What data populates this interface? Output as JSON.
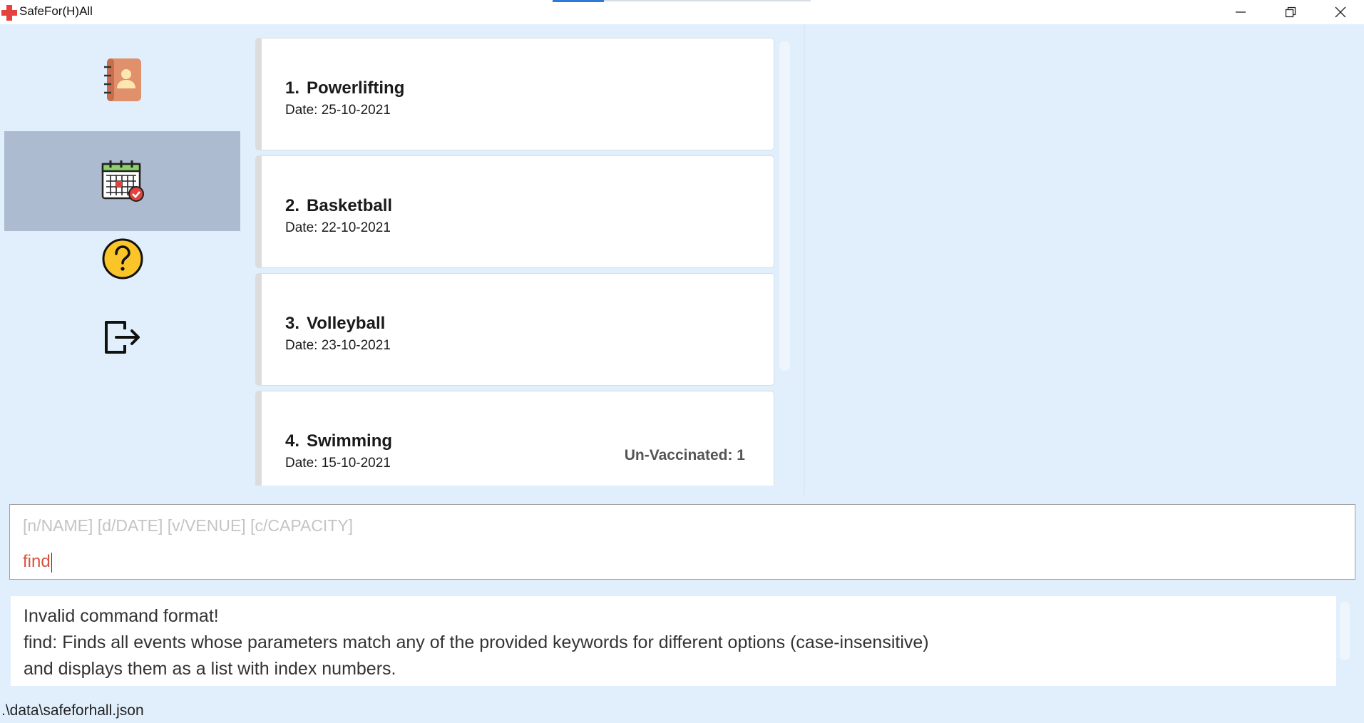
{
  "window": {
    "title": "SafeFor(H)All",
    "icons": {
      "app": "red-cross-icon",
      "minimize": "minimize-icon",
      "maximize": "restore-icon",
      "close": "close-icon"
    }
  },
  "sidebar": {
    "items": [
      {
        "name": "contacts",
        "icon": "address-book-icon",
        "active": false
      },
      {
        "name": "events",
        "icon": "calendar-icon",
        "active": true
      },
      {
        "name": "help",
        "icon": "help-icon",
        "active": false
      },
      {
        "name": "exit",
        "icon": "exit-icon",
        "active": false
      }
    ]
  },
  "events": [
    {
      "index": "1.",
      "name": "Powerlifting",
      "date": "Date: 25-10-2021",
      "badge": ""
    },
    {
      "index": "2.",
      "name": "Basketball",
      "date": "Date: 22-10-2021",
      "badge": ""
    },
    {
      "index": "3.",
      "name": "Volleyball",
      "date": "Date: 23-10-2021",
      "badge": ""
    },
    {
      "index": "4.",
      "name": "Swimming",
      "date": "Date: 15-10-2021",
      "badge": "Un-Vaccinated: 1"
    }
  ],
  "command": {
    "placeholder": "[n/NAME] [d/DATE] [v/VENUE] [c/CAPACITY]",
    "value": "find"
  },
  "result": {
    "lines": [
      "Invalid command format!",
      "find: Finds all events whose parameters match any of the provided keywords for different options (case-insensitive)",
      "and displays them as a list with index numbers."
    ]
  },
  "status": {
    "path": ".\\data\\safeforhall.json"
  },
  "colors": {
    "background": "#e1effc",
    "active_nav": "#acbbcf",
    "command_text": "#d9523f",
    "tab_indicator": "#2d7ad6"
  }
}
